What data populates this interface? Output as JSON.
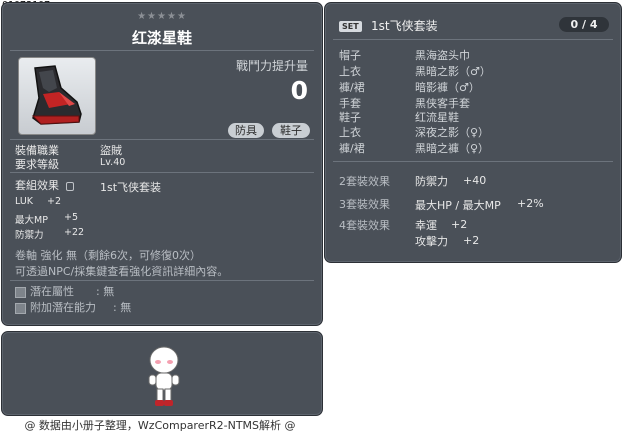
{
  "item_id": "01072107",
  "item": {
    "stars": "★★★★★",
    "name": "红渁星鞋",
    "power_label": "戰鬥力提升量",
    "power_value": "0",
    "tags": [
      "防具",
      "鞋子"
    ],
    "job_label": "裝備職業",
    "job_value": "盜賊",
    "level_label": "要求等級",
    "level_value": "Lv.40",
    "set_label": "套組效果",
    "set_value": "1st飞侠套装",
    "stats": [
      {
        "name": "LUK",
        "value": "+2"
      },
      {
        "name": "最大MP",
        "value": "+5"
      },
      {
        "name": "防禦力",
        "value": "+22"
      }
    ],
    "scroll_text": "卷軸 強化 無（剩餘6次，可修復0次）",
    "npc_text": "可透過NPC/採集鍵查看強化資訊詳細內容。",
    "potential_label": "潛在屬性",
    "potential_value": ": 無",
    "bonus_potential_label": "附加潛在能力",
    "bonus_potential_value": ": 無"
  },
  "set": {
    "badge": "SET",
    "title": "1st飞侠套装",
    "count": "0 / 4",
    "pieces": [
      {
        "slot": "帽子",
        "name": "黑海盗头巾"
      },
      {
        "slot": "上衣",
        "name": "黑暗之影（♂）"
      },
      {
        "slot": "褲/裙",
        "name": "暗影褲（♂）"
      },
      {
        "slot": "手套",
        "name": "黑侠客手套"
      },
      {
        "slot": "鞋子",
        "name": "红流星鞋"
      },
      {
        "slot": "上衣",
        "name": "深夜之影（♀）"
      },
      {
        "slot": "褲/裙",
        "name": "黑暗之褲（♀）"
      }
    ],
    "effects": [
      {
        "label": "2套裝效果",
        "lines": [
          {
            "stat": "防禦力",
            "value": "+40"
          }
        ]
      },
      {
        "label": "3套裝效果",
        "lines": [
          {
            "stat": "最大HP / 最大MP",
            "value": "+2%"
          }
        ]
      },
      {
        "label": "4套裝效果",
        "lines": [
          {
            "stat": "幸運",
            "value": "+2"
          },
          {
            "stat": "攻擊力",
            "value": "+2"
          }
        ]
      }
    ]
  },
  "footer": "@ 数据由小册子整理，WzComparerR2-NTMS解析 @",
  "colors": {
    "panel": "#4a5058",
    "border": "#2c3036",
    "text": "#e8e8e8"
  }
}
